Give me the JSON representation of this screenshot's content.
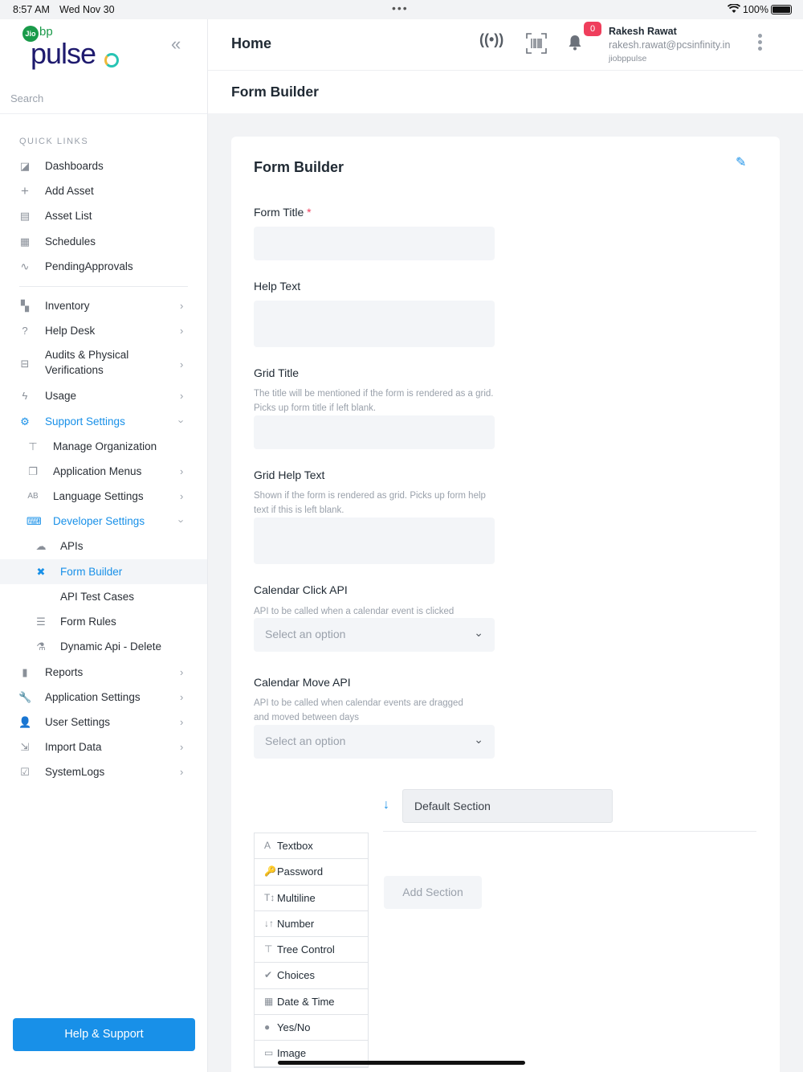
{
  "status": {
    "time": "8:57 AM",
    "date": "Wed Nov 30",
    "battery": "100%"
  },
  "logo": {
    "jio": "Jio",
    "bp": "bp",
    "pulse": "pulse"
  },
  "sidebar": {
    "search_placeholder": "Search",
    "quick_links_label": "QUICK LINKS",
    "quick_links": [
      {
        "label": "Dashboards",
        "icon": "dashboard-icon"
      },
      {
        "label": "Add Asset",
        "icon": "plus-icon"
      },
      {
        "label": "Asset List",
        "icon": "map-icon"
      },
      {
        "label": "Schedules",
        "icon": "calendar-icon"
      },
      {
        "label": "PendingApprovals",
        "icon": "signature-icon"
      }
    ],
    "items": [
      {
        "label": "Inventory"
      },
      {
        "label": "Help Desk"
      },
      {
        "label": "Audits & Physical",
        "label2": "Verifications"
      },
      {
        "label": "Usage"
      },
      {
        "label": "Support Settings"
      },
      {
        "label": "Manage Organization"
      },
      {
        "label": "Application Menus"
      },
      {
        "label": "Language Settings"
      },
      {
        "label": "Developer Settings"
      },
      {
        "label": "APIs"
      },
      {
        "label": "Form Builder"
      },
      {
        "label": "API Test Cases"
      },
      {
        "label": "Form Rules"
      },
      {
        "label": "Dynamic Api - Delete"
      },
      {
        "label": "Reports"
      },
      {
        "label": "Application Settings"
      },
      {
        "label": "User Settings"
      },
      {
        "label": "Import Data"
      },
      {
        "label": "SystemLogs"
      }
    ],
    "help_button": "Help & Support"
  },
  "header": {
    "title": "Home",
    "notification_count": "0",
    "user_name": "Rakesh Rawat",
    "user_email": "rakesh.rawat@pcsinfinity.in",
    "user_org": "jiobppulse"
  },
  "subheader": {
    "title": "Form Builder"
  },
  "form": {
    "title": "Form Builder",
    "form_title_label": "Form Title",
    "required_mark": "*",
    "help_text_label": "Help Text",
    "grid_title_label": "Grid Title",
    "grid_title_help": "The title will be mentioned if the form is rendered as a grid. Picks up form title if left blank.",
    "grid_help_label": "Grid Help Text",
    "grid_help_help": "Shown if the form is rendered as grid. Picks up form help text if this is left blank.",
    "cal_click_label": "Calendar Click API",
    "cal_click_help": "API to be called when a calendar event is clicked",
    "cal_click_placeholder": "Select an option",
    "cal_move_label": "Calendar Move API",
    "cal_move_help": "API to be called when calendar events are dragged and moved between days",
    "cal_move_placeholder": "Select an option",
    "default_section": "Default Section",
    "add_section": "Add Section",
    "palette": [
      {
        "label": "Textbox",
        "glyph": "A"
      },
      {
        "label": "Password",
        "glyph": "🔑"
      },
      {
        "label": "Multiline",
        "glyph": "T↕"
      },
      {
        "label": "Number",
        "glyph": "↓↑"
      },
      {
        "label": "Tree Control",
        "glyph": "⊤"
      },
      {
        "label": "Choices",
        "glyph": "✔"
      },
      {
        "label": "Date & Time",
        "glyph": "▦"
      },
      {
        "label": "Yes/No",
        "glyph": "●"
      },
      {
        "label": "Image",
        "glyph": "▭"
      }
    ]
  }
}
